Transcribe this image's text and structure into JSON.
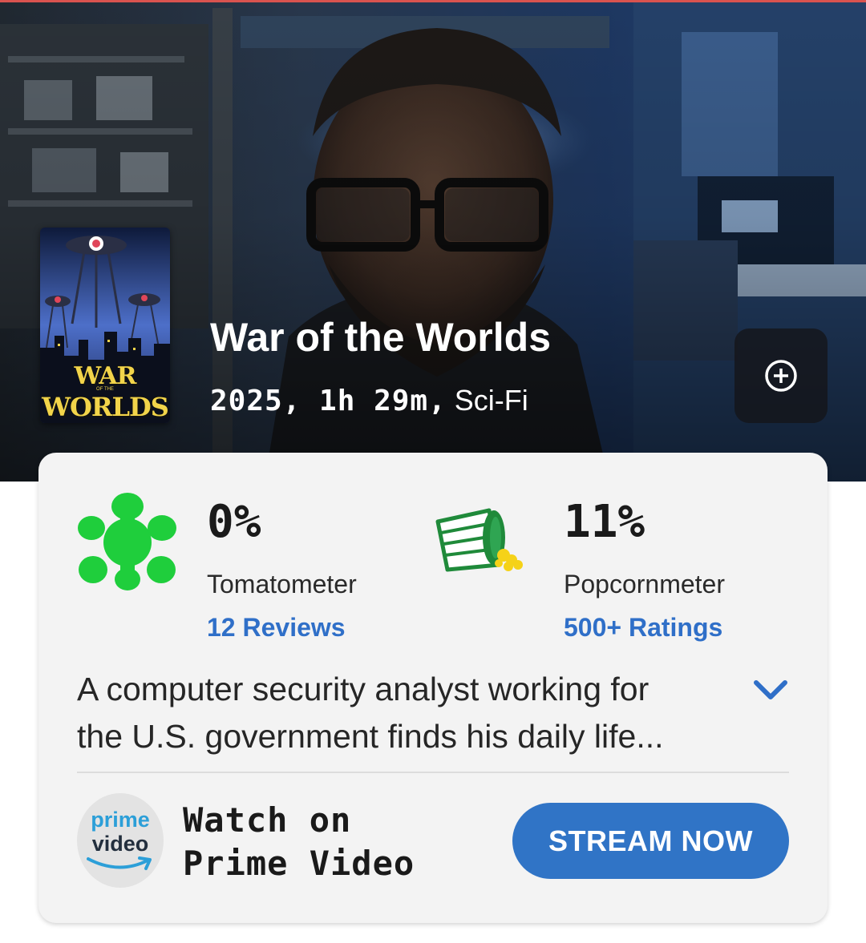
{
  "movie": {
    "title": "War of the Worlds",
    "year_duration": "2025, 1h 29m,",
    "genre": "Sci-Fi"
  },
  "poster": {
    "title_line1": "WAR",
    "title_small": "OF THE",
    "title_line2": "WORLDS"
  },
  "add_button": {
    "icon": "plus-circle-icon"
  },
  "tomatometer": {
    "value": "0%",
    "label": "Tomatometer",
    "reviews_link": "12 Reviews",
    "icon": "green-splat-icon",
    "icon_color": "#1fce3c"
  },
  "popcornmeter": {
    "value": "11%",
    "label": "Popcornmeter",
    "ratings_link": "500+ Ratings",
    "icon": "tipped-popcorn-bucket-icon",
    "icon_color": "#1f8a3a"
  },
  "synopsis": {
    "line1": "A computer security analyst working for",
    "line2": "the U.S. government finds his daily life...",
    "expand_icon": "chevron-down-icon"
  },
  "streaming": {
    "provider_logo_line1": "prime",
    "provider_logo_line2": "video",
    "watch_line1": "Watch on",
    "watch_line2": "Prime Video",
    "button_label": "STREAM NOW"
  },
  "colors": {
    "link_blue": "#2f6fc8",
    "button_blue": "#3074c6",
    "card_bg": "#f3f3f3"
  }
}
